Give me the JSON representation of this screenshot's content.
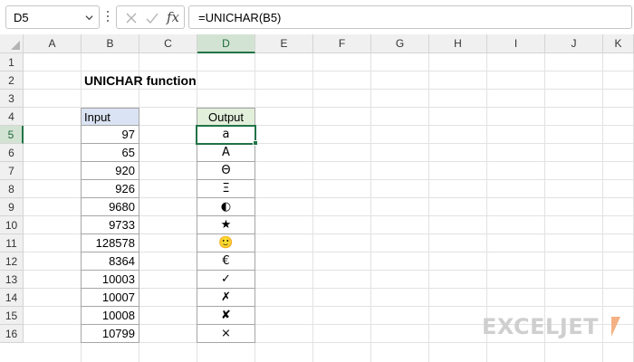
{
  "formula_bar": {
    "name_box": "D5",
    "fx_label": "fx",
    "formula": "=UNICHAR(B5)"
  },
  "columns": [
    "A",
    "B",
    "C",
    "D",
    "E",
    "F",
    "G",
    "H",
    "I",
    "J",
    "K"
  ],
  "rows": [
    "1",
    "2",
    "3",
    "4",
    "5",
    "6",
    "7",
    "8",
    "9",
    "10",
    "11",
    "12",
    "13",
    "14",
    "15",
    "16"
  ],
  "selected_cell": "D5",
  "sheet": {
    "title": "UNICHAR function",
    "input_header": "Input",
    "output_header": "Output",
    "inputs": [
      "97",
      "65",
      "920",
      "926",
      "9680",
      "9733",
      "128578",
      "8364",
      "10003",
      "10007",
      "10008",
      "10799"
    ],
    "outputs": [
      "a",
      "A",
      "Θ",
      "Ξ",
      "◐",
      "★",
      "🙂",
      "€",
      "✓",
      "✗",
      "✘",
      "⨯"
    ]
  },
  "watermark": {
    "text": "EXCELJET"
  },
  "colors": {
    "accent": "#217346",
    "input_header_bg": "#dae3f3",
    "output_header_bg": "#e2efda"
  }
}
